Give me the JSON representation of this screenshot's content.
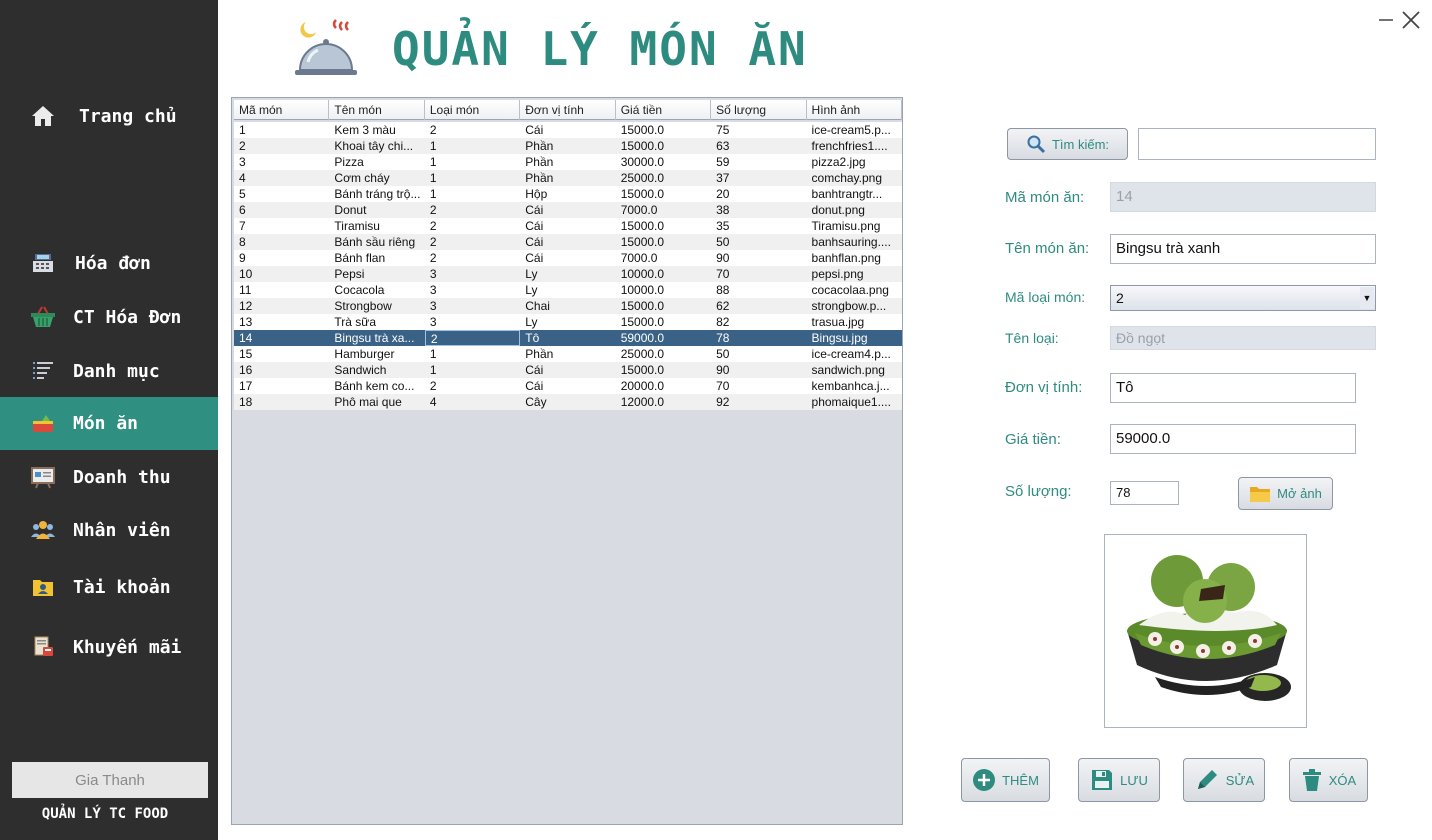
{
  "app": {
    "title": "QUẢN LÝ MÓN ĂN",
    "caption": "QUẢN LÝ TC FOOD",
    "user": "Gia Thanh"
  },
  "sidebar": {
    "items": [
      {
        "label": "Trang chủ",
        "icon": "home-icon",
        "active": false
      },
      {
        "label": "Hóa đơn",
        "icon": "cash-register-icon",
        "active": false
      },
      {
        "label": "CT Hóa Đơn",
        "icon": "basket-icon",
        "active": false
      },
      {
        "label": "Danh mục",
        "icon": "list-icon",
        "active": false
      },
      {
        "label": "Món ăn",
        "icon": "food-icon",
        "active": true
      },
      {
        "label": "Doanh thu",
        "icon": "revenue-board-icon",
        "active": false
      },
      {
        "label": "Nhân viên",
        "icon": "people-icon",
        "active": false
      },
      {
        "label": "Tài khoản",
        "icon": "account-folder-icon",
        "active": false
      },
      {
        "label": "Khuyến mãi",
        "icon": "promotion-icon",
        "active": false
      }
    ]
  },
  "table": {
    "columns": [
      "Mã món",
      "Tên món",
      "Loại món",
      "Đơn vị tính",
      "Giá tiền",
      "Số lượng",
      "Hình ảnh"
    ],
    "rows": [
      [
        "1",
        "Kem 3 màu",
        "2",
        "Cái",
        "15000.0",
        "75",
        "ice-cream5.p..."
      ],
      [
        "2",
        "Khoai tây chi...",
        "1",
        "Phần",
        "15000.0",
        "63",
        "frenchfries1...."
      ],
      [
        "3",
        "Pizza",
        "1",
        "Phần",
        "30000.0",
        "59",
        "pizza2.jpg"
      ],
      [
        "4",
        "Cơm cháy",
        "1",
        "Phần",
        "25000.0",
        "37",
        "comchay.png"
      ],
      [
        "5",
        "Bánh tráng trộ...",
        "1",
        "Hộp",
        "15000.0",
        "20",
        "banhtrangtr..."
      ],
      [
        "6",
        "Donut",
        "2",
        "Cái",
        "7000.0",
        "38",
        "donut.png"
      ],
      [
        "7",
        "Tiramisu",
        "2",
        "Cái",
        "15000.0",
        "35",
        "Tiramisu.png"
      ],
      [
        "8",
        "Bánh sầu riêng",
        "2",
        "Cái",
        "15000.0",
        "50",
        "banhsauring...."
      ],
      [
        "9",
        "Bánh flan",
        "2",
        "Cái",
        "7000.0",
        "90",
        "banhflan.png"
      ],
      [
        "10",
        "Pepsi",
        "3",
        "Ly",
        "10000.0",
        "70",
        "pepsi.png"
      ],
      [
        "11",
        "Cocacola",
        "3",
        "Ly",
        "10000.0",
        "88",
        "cocacolaa.png"
      ],
      [
        "12",
        "Strongbow",
        "3",
        "Chai",
        "15000.0",
        "62",
        "strongbow.p..."
      ],
      [
        "13",
        "Trà sữa",
        "3",
        "Ly",
        "15000.0",
        "82",
        "trasua.jpg"
      ],
      [
        "14",
        "Bingsu trà xa...",
        "2",
        "Tô",
        "59000.0",
        "78",
        "Bingsu.jpg"
      ],
      [
        "15",
        "Hamburger",
        "1",
        "Phần",
        "25000.0",
        "50",
        "ice-cream4.p..."
      ],
      [
        "16",
        "Sandwich",
        "1",
        "Cái",
        "15000.0",
        "90",
        "sandwich.png"
      ],
      [
        "17",
        "Bánh kem co...",
        "2",
        "Cái",
        "20000.0",
        "70",
        "kembanhca.j..."
      ],
      [
        "18",
        "Phô mai que",
        "4",
        "Cây",
        "12000.0",
        "92",
        "phomaique1...."
      ]
    ],
    "selected_row": 13
  },
  "form": {
    "search_button": "Tìm kiếm:",
    "search_value": "",
    "ma_mon_label": "Mã món ăn:",
    "ma_mon_value": "14",
    "ten_mon_label": "Tên món ăn:",
    "ten_mon_value": "Bingsu trà xanh",
    "ma_loai_label": "Mã loại món:",
    "ma_loai_value": "2",
    "ten_loai_label": "Tên loại:",
    "ten_loai_value": "Đồ ngọt",
    "don_vi_label": "Đơn vị tính:",
    "don_vi_value": "Tô",
    "gia_label": "Giá tiền:",
    "gia_value": "59000.0",
    "so_luong_label": "Số lượng:",
    "so_luong_value": "78",
    "open_image_button": "Mở ảnh"
  },
  "actions": {
    "add": "THÊM",
    "save": "LƯU",
    "edit": "SỬA",
    "delete": "XÓA"
  },
  "colors": {
    "accent": "#2e8b80",
    "sidebar_bg": "#2e2e2e",
    "selected_row": "#3a6186"
  }
}
